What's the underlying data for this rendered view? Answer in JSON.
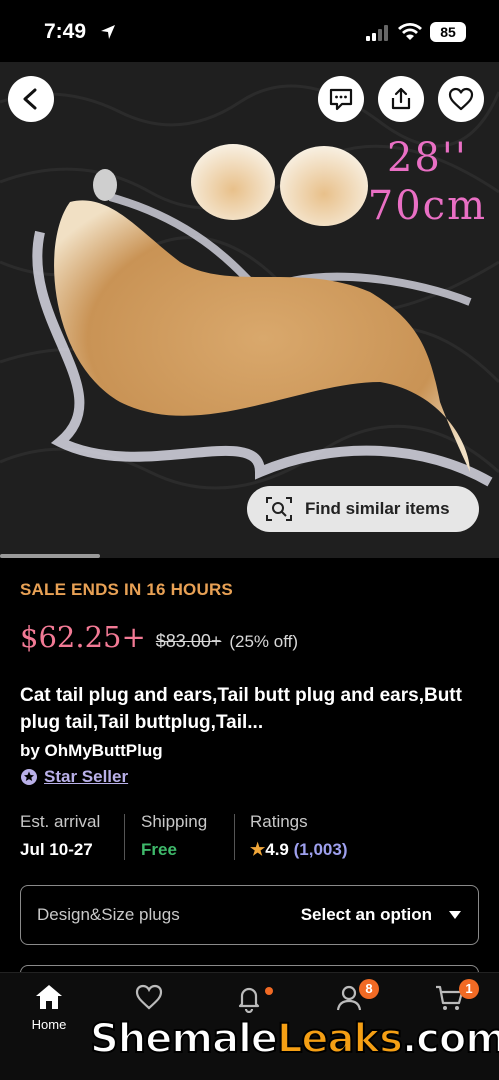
{
  "status": {
    "time": "7:49",
    "battery": "85"
  },
  "image": {
    "size_line1": "28''",
    "size_line2": "70cm",
    "find_similar_label": "Find similar items"
  },
  "listing": {
    "sale_text": "SALE ENDS IN 16 HOURS",
    "price": "$62.25+",
    "old_price": "$83.00+",
    "discount": "(25% off)",
    "title": "Cat tail plug and ears,Tail butt plug and ears,Butt plug tail,Tail buttplug,Tail...",
    "seller": "by OhMyButtPlug",
    "star_seller": "Star Seller"
  },
  "info": {
    "arrival_label": "Est. arrival",
    "arrival_value": "Jul 10-27",
    "shipping_label": "Shipping",
    "shipping_value": "Free",
    "ratings_label": "Ratings",
    "rating_star": "★",
    "rating_value": "4.9",
    "rating_count": "(1,003)"
  },
  "options": {
    "label": "Design&Size plugs",
    "value": "Select an option"
  },
  "nav": {
    "home": "Home",
    "you_badge": "8",
    "cart_badge": "1"
  },
  "watermark": {
    "part1": "Shemale",
    "part2": "Leaks",
    "part3": ".com"
  },
  "colors": {
    "sale": "#e8a155",
    "price": "#f27a95",
    "free": "#3fb96b",
    "rating_count": "#9ea0ee",
    "badge": "#f16a24"
  }
}
